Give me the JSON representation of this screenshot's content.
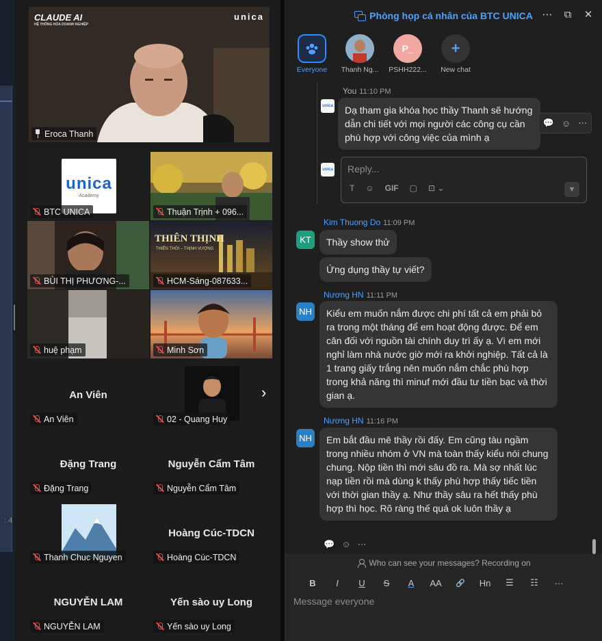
{
  "gallery": {
    "featured": {
      "name": "Eroca Thanh",
      "brand": "CLAUDE AI",
      "subtitle": "HỆ THỐNG HÓA DOANH NGHIỆP",
      "logo": "unica"
    },
    "tiles": [
      {
        "name": "BTC UNICA",
        "kind": "unica-logo",
        "logo_text": "unica",
        "logo_sub": "Academy"
      },
      {
        "name": "Thuận Trịnh + 096...",
        "kind": "video",
        "bg": "#8a6a2c"
      },
      {
        "name": "BÙI THỊ PHƯƠNG-...",
        "kind": "video",
        "bg": "#3b2a20"
      },
      {
        "name": "HCM-Sáng-087633...",
        "kind": "banner",
        "banner_title": "THIÊN THỊNH",
        "banner_sub": "THIÊN THỜI – THỊNH VƯỢNG"
      },
      {
        "name": "huệ phạm",
        "kind": "video",
        "bg": "#3a3834"
      },
      {
        "name": "Minh Sơn",
        "kind": "avatar3d"
      },
      {
        "name": "An Viên",
        "kind": "name-only"
      },
      {
        "name": "02 - Quang Huy",
        "kind": "photo"
      },
      {
        "name": "Đặng Trang",
        "kind": "name-only"
      },
      {
        "name": "Nguyễn Cẩm Tâm",
        "kind": "name-only"
      },
      {
        "name": "Thanh Chuc Nguyen",
        "kind": "mountain"
      },
      {
        "name": "Hoàng Cúc-TDCN",
        "kind": "name-only"
      },
      {
        "name": "NGUYỄN LAM",
        "kind": "name-only"
      },
      {
        "name": "Yến sào uy Long",
        "kind": "name-only"
      }
    ],
    "next_page_icon": "chevron-right-icon",
    "left_tick": ": 4"
  },
  "chat": {
    "title": "Phòng họp cá nhân của BTC UNICA",
    "header_icons": [
      "more-icon",
      "popout-icon",
      "close-icon"
    ],
    "recipients": [
      {
        "label": "Everyone",
        "initials": "",
        "color": "#1b2c44",
        "active": true
      },
      {
        "label": "Thanh Ng...",
        "initials": "",
        "color": "#7a5a4a",
        "active": false
      },
      {
        "label": "PSHH222...",
        "initials": "P_",
        "color": "#f0a8a0",
        "active": false
      },
      {
        "label": "New chat",
        "initials": "+",
        "color": "#333333",
        "active": false
      }
    ],
    "messages": [
      {
        "sender": "You",
        "time": "11:10 PM",
        "text": "Dạ tham gia khóa học thầy Thanh sẽ hướng dẫn chi tiết với mọi người các công cụ cần phù hợp với công việc của mình ạ"
      },
      {
        "sender": "Kim Thuong Do",
        "time": "11:09 PM",
        "initials": "KT",
        "avatar_color": "#1e9e7e",
        "texts": [
          "Thầy show thử",
          "Ứng dụng thầy tự viết?"
        ]
      },
      {
        "sender": "Nương HN",
        "time": "11:11 PM",
        "initials": "NH",
        "avatar_color": "#2b7fc4",
        "text": "Kiểu em muốn nắm được chi phí tất cả em phải bỏ ra trong một tháng để em hoạt động được. Để em cân đối với nguồn tài chính duy trì ấy ạ. Vì em mới nghỉ làm nhà nước giờ mới ra khởi nghiệp. Tất cả là 1 trang giấy trắng nên muốn nắm chắc phù hợp trong khả năng thì minuf mới đầu tư tiền bạc và thời gian ạ."
      },
      {
        "sender": "Nương HN",
        "time": "11:16 PM",
        "initials": "NH",
        "avatar_color": "#2b7fc4",
        "text": "Em bắt đầu mê thầy rồi đấy. Em cũng tàu ngầm trong nhiều nhóm ở VN mà toàn thấy kiểu nói chung chung. Nộp tiền thì mới sâu đồ ra. Mà sợ nhất lúc nạp tiền rồi mà dùng k thấy phù hợp thấy tiếc tiền với thời gian thầy ạ. Như thầy sâu ra hết thấy phù hợp thì học. Rõ ràng thế quá ok luôn thầy ạ"
      }
    ],
    "reply_placeholder": "Reply...",
    "reply_tools": [
      "T",
      "☺",
      "GIF",
      "▢",
      "⊡ ⌄"
    ],
    "privacy_text": "Who can see your messages? Recording on",
    "format_tools": [
      "B",
      "I",
      "U",
      "S",
      "A",
      "AA",
      "🔗",
      "Hn",
      "☰",
      "☷",
      "···"
    ],
    "compose_placeholder": "Message everyone"
  }
}
